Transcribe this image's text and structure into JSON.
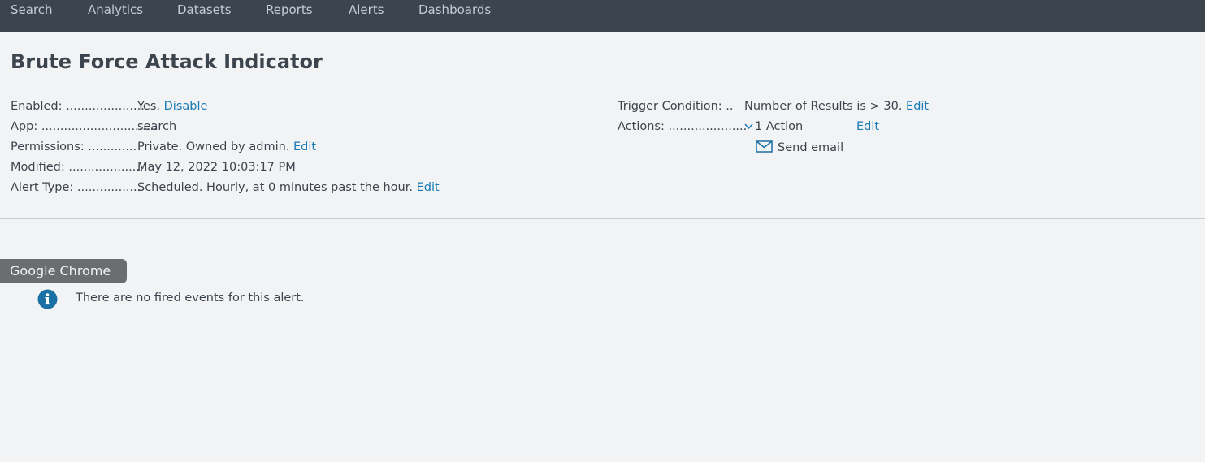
{
  "nav": {
    "items": [
      "Search",
      "Analytics",
      "Datasets",
      "Reports",
      "Alerts",
      "Dashboards"
    ]
  },
  "alert": {
    "title": "Brute Force Attack Indicator",
    "enabled_label": "Enabled: .....................",
    "enabled_value": "Yes.",
    "enabled_link": "Disable",
    "app_label": "App: ...............................",
    "app_value": "search",
    "permissions_label": "Permissions: .............",
    "permissions_value": "Private. Owned by admin.",
    "permissions_link": "Edit",
    "modified_label": "Modified: ....................",
    "modified_value": "May 12, 2022 10:03:17 PM",
    "alert_type_label": "Alert Type: .................",
    "alert_type_value": "Scheduled. Hourly, at 0 minutes past the hour.",
    "alert_type_link": "Edit",
    "trigger_label": "Trigger Condition: ..",
    "trigger_value": "Number of Results is > 30.",
    "trigger_link": "Edit",
    "actions_label": "Actions: .....................",
    "actions_value": "1 Action",
    "actions_link": "Edit",
    "action_item": "Send email"
  },
  "tooltip": {
    "text": "Google Chrome"
  },
  "events": {
    "message": "There are no fired events for this alert."
  },
  "colors": {
    "navbar": "#3c444d",
    "link": "#1a7bb5",
    "info_icon": "#1a6fa3",
    "background": "#f2f3f5"
  },
  "icons": [
    "chevron-down-icon",
    "envelope-icon",
    "info-icon"
  ]
}
